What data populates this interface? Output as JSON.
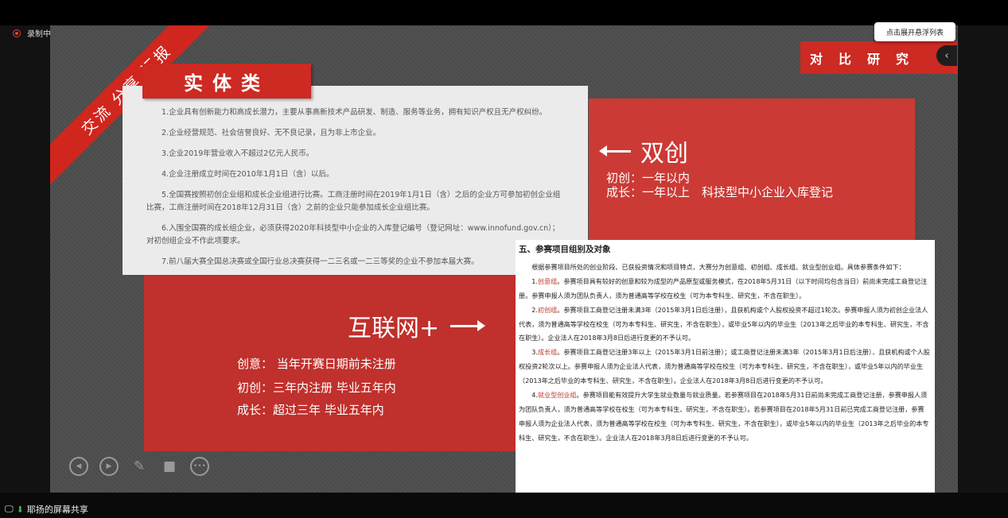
{
  "recording": {
    "label": "录制中"
  },
  "ribbon": {
    "text": "交流 分享 汇报"
  },
  "title": "实体类",
  "compare": "对比研究",
  "tooltip": "点击展开悬浮列表",
  "side_tab_icon": "‹",
  "entity_items": [
    "1.企业具有创新能力和高成长潜力，主要从事高新技术产品研发、制造、服务等业务，拥有知识产权且无产权纠纷。",
    "2.企业经营规范、社会信誉良好、无不良记录，且为非上市企业。",
    "3.企业2019年营业收入不超过2亿元人民币。",
    "4.企业注册成立时间在2010年1月1日（含）以后。",
    "5.全国赛按照初创企业组和成长企业组进行比赛。工商注册时间在2019年1月1日（含）之后的企业方可参加初创企业组比赛，工商注册时间在2018年12月31日（含）之前的企业只能参加成长企业组比赛。",
    "6.入围全国赛的成长组企业，必须获得2020年科技型中小企业的入库登记编号（登记网址：www.innofund.gov.cn）；对初创组企业不作此项要求。",
    "7.前八届大赛全国总决赛或全国行业总决赛获得一二三名或一二三等奖的企业不参加本届大赛。"
  ],
  "shuangchuang": {
    "heading": "双创",
    "line1": "初创：一年以内",
    "line2": "成长：一年以上　科技型中小企业入库登记"
  },
  "internet": {
    "heading": "互联网+",
    "lines": [
      "创意：  当年开赛日期前未注册",
      "初创：三年内注册  毕业五年内",
      "成长：超过三年  毕业五年内"
    ]
  },
  "doc": {
    "heading": "五、参赛项目组别及对象",
    "intro": "根据参赛项目所处的创业阶段、已获投资情况和项目特点，大赛分为创意组、初创组、成长组、就业型创业组。具体参赛条件如下：",
    "items": [
      {
        "num": "1.",
        "hl": "创意组",
        "text": "。参赛项目具有较好的创意和较为成型的产品原型或服务模式，在2018年5月31日（以下时间均包含当日）前尚未完成工商登记注册。参赛申报人须为团队负责人，须为普通高等学校在校生（可为本专科生、研究生，不含在职生）。"
      },
      {
        "num": "2.",
        "hl": "初创组",
        "text": "。参赛项目工商登记注册未满3年（2015年3月1日后注册），且获机构或个人股权投资不超过1轮次。参赛申报人须为初创企业法人代表，须为普通高等学校在校生（可为本专科生、研究生，不含在职生），或毕业5年以内的毕业生（2013年之后毕业的本专科生、研究生，不含在职生）。企业法人在2018年3月8日后进行变更的不予认可。"
      },
      {
        "num": "3.",
        "hl": "成长组",
        "text": "。参赛项目工商登记注册3年以上（2015年3月1日前注册）；或工商登记注册未满3年（2015年3月1日后注册），且获机构或个人股权投资2轮次以上。参赛申报人须为企业法人代表，须为普通高等学校在校生（可为本专科生、研究生，不含在职生），或毕业5年以内的毕业生（2013年之后毕业的本专科生、研究生，不含在职生）。企业法人在2018年3月8日后进行变更的不予认可。"
      },
      {
        "num": "4.",
        "hl": "就业型创业组",
        "text": "。参赛项目能有效提升大学生就业数量与就业质量。若参赛项目在2018年5月31日前尚未完成工商登记注册，参赛申报人须为团队负责人，须为普通高等学校在校生（可为本专科生、研究生，不含在职生）。若参赛项目在2018年5月31日前已完成工商登记注册，参赛申报人须为企业法人代表，须为普通高等学校在校生（可为本专科生、研究生，不含在职生），或毕业5年以内的毕业生（2013年之后毕业的本专科生、研究生，不含在职生）。企业法人在2018年3月8日后进行变更的不予认可。"
      }
    ]
  },
  "controls": [
    {
      "name": "prev-slide-button",
      "icon": "◀",
      "style": "ring"
    },
    {
      "name": "next-slide-button",
      "icon": "▶",
      "style": "ring"
    },
    {
      "name": "pen-button",
      "icon": "✎",
      "style": "plain"
    },
    {
      "name": "camera-button",
      "icon": "■",
      "style": "plain"
    },
    {
      "name": "more-button",
      "icon": "•••",
      "style": "ring"
    }
  ],
  "share": {
    "label": "耶扬的屏幕共享"
  }
}
